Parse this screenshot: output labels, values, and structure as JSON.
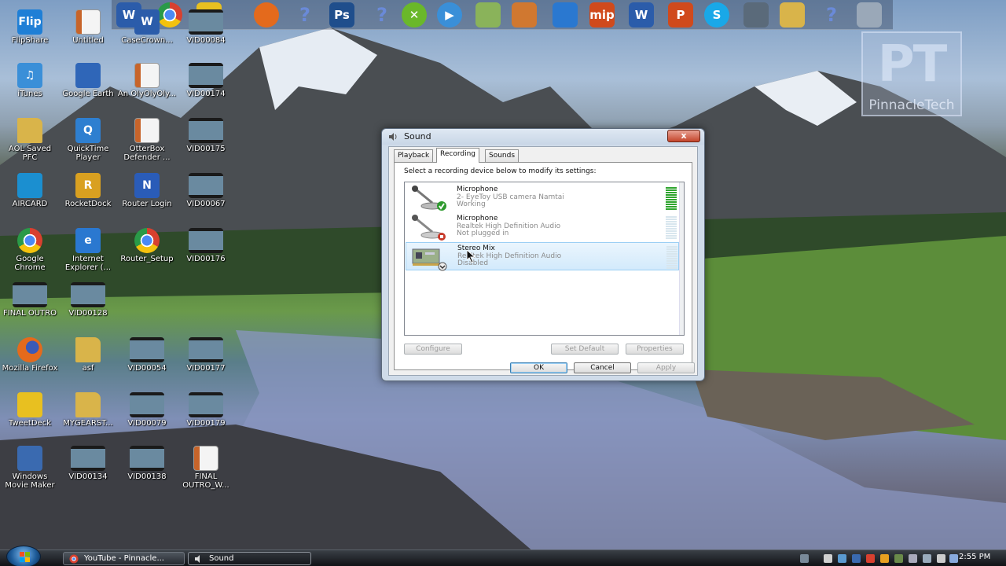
{
  "desktop": {
    "watermark": {
      "letters": "PT",
      "name": "PinnacleTech"
    },
    "icons": [
      {
        "label": "FlipShare",
        "icon": "flipshare-icon",
        "color": "#1f7fd6",
        "glyph": "Flip"
      },
      {
        "label": "Untitled",
        "icon": "video-file-icon",
        "color": "#e5e5e5",
        "glyph": ""
      },
      {
        "label": "CaseCrown...",
        "icon": "word-document-icon",
        "color": "#2b5caa",
        "glyph": "W"
      },
      {
        "label": "VID00084",
        "icon": "video-thumbnail-icon",
        "color": "#3a5a6a",
        "glyph": ""
      },
      {
        "label": "iTunes",
        "icon": "itunes-icon",
        "color": "#3a8fd8",
        "glyph": "♫"
      },
      {
        "label": "Google Earth",
        "icon": "google-earth-icon",
        "color": "#2f66b8",
        "glyph": ""
      },
      {
        "label": "An OlyOlyOly...",
        "icon": "video-file-icon",
        "color": "#e5e5e5",
        "glyph": ""
      },
      {
        "label": "VID00174",
        "icon": "video-thumbnail-icon",
        "color": "#3a5a6a",
        "glyph": ""
      },
      {
        "label": "AOL Saved PFC",
        "icon": "folder-icon",
        "color": "#d9b44a",
        "glyph": ""
      },
      {
        "label": "QuickTime Player",
        "icon": "quicktime-icon",
        "color": "#2e7fd0",
        "glyph": "Q"
      },
      {
        "label": "OtterBox Defender ...",
        "icon": "video-file-icon",
        "color": "#e5e5e5",
        "glyph": ""
      },
      {
        "label": "VID00175",
        "icon": "video-thumbnail-icon",
        "color": "#3a5a6a",
        "glyph": ""
      },
      {
        "label": "AIRCARD",
        "icon": "att-globe-icon",
        "color": "#1b8fd0",
        "glyph": ""
      },
      {
        "label": "RocketDock",
        "icon": "rocketdock-icon",
        "color": "#d9a020",
        "glyph": "R"
      },
      {
        "label": "Router Login",
        "icon": "network-icon",
        "color": "#2a5cb8",
        "glyph": "N"
      },
      {
        "label": "VID00067",
        "icon": "video-thumbnail-icon",
        "color": "#3a5a6a",
        "glyph": ""
      },
      {
        "label": "Google Chrome",
        "icon": "chrome-icon",
        "color": "#d8402f",
        "glyph": ""
      },
      {
        "label": "Internet Explorer (...",
        "icon": "internet-explorer-icon",
        "color": "#2a78d0",
        "glyph": "e"
      },
      {
        "label": "Router_Setup",
        "icon": "chrome-icon",
        "color": "#d8402f",
        "glyph": ""
      },
      {
        "label": "VID00176",
        "icon": "video-thumbnail-icon",
        "color": "#3a5a6a",
        "glyph": ""
      },
      {
        "label": "FINAL OUTRO",
        "icon": "video-thumbnail-icon",
        "color": "#3a5a6a",
        "glyph": ""
      },
      {
        "label": "VID00128",
        "icon": "video-thumbnail-icon",
        "color": "#3a5a6a",
        "glyph": ""
      },
      {
        "label": "Mozilla Firefox",
        "icon": "firefox-icon",
        "color": "#e46a1c",
        "glyph": ""
      },
      {
        "label": "asf",
        "icon": "folder-icon",
        "color": "#d9b44a",
        "glyph": ""
      },
      {
        "label": "VID00054",
        "icon": "video-thumbnail-icon",
        "color": "#3a5a6a",
        "glyph": ""
      },
      {
        "label": "VID00177",
        "icon": "video-thumbnail-icon",
        "color": "#3a5a6a",
        "glyph": ""
      },
      {
        "label": "TweetDeck",
        "icon": "tweetdeck-icon",
        "color": "#e8c020",
        "glyph": ""
      },
      {
        "label": "MYGEARST...",
        "icon": "folder-icon",
        "color": "#d9b44a",
        "glyph": ""
      },
      {
        "label": "VID00079",
        "icon": "video-thumbnail-icon",
        "color": "#3a5a6a",
        "glyph": ""
      },
      {
        "label": "VID00179",
        "icon": "video-thumbnail-icon",
        "color": "#3a5a6a",
        "glyph": ""
      },
      {
        "label": "Windows Movie Maker",
        "icon": "movie-maker-icon",
        "color": "#3a6ab0",
        "glyph": ""
      },
      {
        "label": "VID00134",
        "icon": "video-thumbnail-icon",
        "color": "#3a5a6a",
        "glyph": ""
      },
      {
        "label": "VID00138",
        "icon": "video-thumbnail-icon",
        "color": "#3a5a6a",
        "glyph": ""
      },
      {
        "label": "FINAL OUTRO_W...",
        "icon": "video-file-icon",
        "color": "#e5e5e5",
        "glyph": ""
      }
    ]
  },
  "dock": {
    "items": [
      {
        "icon": "word-document-icon",
        "color": "#2b5caa",
        "glyph": "W"
      },
      {
        "icon": "chrome-icon",
        "color": "#d8402f",
        "glyph": ""
      },
      {
        "icon": "tweetdeck-icon",
        "color": "#e8c020",
        "glyph": ""
      },
      {
        "icon": "firefox-icon",
        "color": "#e46a1c",
        "glyph": ""
      },
      {
        "icon": "help-icon",
        "color": "#3d6fc8",
        "glyph": "?"
      },
      {
        "icon": "photoshop-icon",
        "color": "#1f4e8c",
        "glyph": "Ps"
      },
      {
        "icon": "help-icon",
        "color": "#3d6fc8",
        "glyph": "?"
      },
      {
        "icon": "xbox-icon",
        "color": "#6ab82a",
        "glyph": "✕"
      },
      {
        "icon": "media-player-icon",
        "color": "#3a8fd8",
        "glyph": "▶"
      },
      {
        "icon": "image-file-icon",
        "color": "#8ab35a",
        "glyph": ""
      },
      {
        "icon": "video-file-icon",
        "color": "#d07830",
        "glyph": ""
      },
      {
        "icon": "headset-icon",
        "color": "#2a78d0",
        "glyph": ""
      },
      {
        "icon": "mip-icon",
        "color": "#d04a1c",
        "glyph": "mip"
      },
      {
        "icon": "word-icon",
        "color": "#2b5caa",
        "glyph": "W"
      },
      {
        "icon": "powerpoint-icon",
        "color": "#d04a1c",
        "glyph": "P"
      },
      {
        "icon": "skype-icon",
        "color": "#19a8e8",
        "glyph": "S"
      },
      {
        "icon": "flag-icon",
        "color": "#5a6a7a",
        "glyph": ""
      },
      {
        "icon": "folder-icon",
        "color": "#d9b44a",
        "glyph": ""
      },
      {
        "icon": "help-icon",
        "color": "#3d6fc8",
        "glyph": "?"
      },
      {
        "icon": "recycle-bin-icon",
        "color": "#9aa8b8",
        "glyph": ""
      }
    ]
  },
  "dialog": {
    "title": "Sound",
    "close_label": "x",
    "tabs": [
      {
        "label": "Playback",
        "active": false
      },
      {
        "label": "Recording",
        "active": true
      },
      {
        "label": "Sounds",
        "active": false
      }
    ],
    "hint": "Select a recording device below to modify its settings:",
    "devices": [
      {
        "name": "Microphone",
        "desc": "2- EyeToy USB camera Namtai",
        "status": "Working",
        "icon": "microphone-icon",
        "badge": "check",
        "level": 1.0,
        "selected": false
      },
      {
        "name": "Microphone",
        "desc": "Realtek High Definition Audio",
        "status": "Not plugged in",
        "icon": "microphone-icon",
        "badge": "unplugged",
        "level": 0.0,
        "selected": false
      },
      {
        "name": "Stereo Mix",
        "desc": "Realtek High Definition Audio",
        "status": "Disabled",
        "icon": "sound-card-icon",
        "badge": "disabled",
        "level": 0.0,
        "selected": true
      }
    ],
    "buttons": {
      "configure": "Configure",
      "set_default": "Set Default",
      "properties": "Properties",
      "ok": "OK",
      "cancel": "Cancel",
      "apply": "Apply"
    }
  },
  "taskbar": {
    "tasks": [
      {
        "label": "YouTube - Pinnacle...",
        "icon": "chrome-icon",
        "active": false
      },
      {
        "label": "Sound",
        "icon": "speaker-icon",
        "active": true
      }
    ],
    "clock": "2:55 PM"
  }
}
